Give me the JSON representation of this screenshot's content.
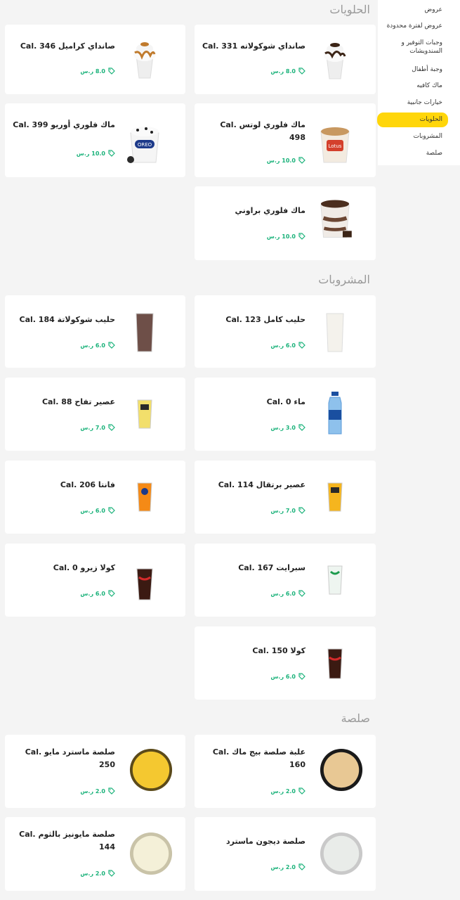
{
  "sidebar": {
    "items": [
      {
        "label": "عروض"
      },
      {
        "label": "عروض لفترة محدودة"
      },
      {
        "label": "وجبات التوفير و السندويشات"
      },
      {
        "label": "وجبة أطفال"
      },
      {
        "label": "ماك كافيه"
      },
      {
        "label": "خيارات جانبية"
      },
      {
        "label": "الحلويات"
      },
      {
        "label": "المشروبات"
      },
      {
        "label": "صلصة"
      }
    ],
    "active_index": 6,
    "active_color": "#ffd60a"
  },
  "sections": {
    "desserts": "الحلويات",
    "drinks": "المشروبات",
    "sauces": "صلصة"
  },
  "cards": {
    "sundae_choc": {
      "name": "صانداي شوكولاته Cal. 331",
      "price": "8.0 ر.س"
    },
    "sundae_caramel": {
      "name": "صانداي كراميل Cal. 346",
      "price": "8.0 ر.س"
    },
    "mcflurry_lotus": {
      "name": "ماك فلوري لوتس Cal. 498",
      "price": "10.0 ر.س"
    },
    "mcflurry_oreo": {
      "name": "ماك فلوري أوريو Cal. 399",
      "price": "10.0 ر.س"
    },
    "mcflurry_brownie": {
      "name": "ماك فلوري براوني",
      "price": "10.0 ر.س"
    },
    "milk_full": {
      "name": "حليب كامل Cal. 123",
      "price": "6.0 ر.س"
    },
    "milk_choc": {
      "name": "حليب شوكولاتة Cal. 184",
      "price": "6.0 ر.س"
    },
    "water": {
      "name": "ماء Cal. 0",
      "price": "3.0 ر.س"
    },
    "apple_juice": {
      "name": "عصير تفاح Cal. 88",
      "price": "7.0 ر.س"
    },
    "orange_juice": {
      "name": "عصير برتقال Cal. 114",
      "price": "7.0 ر.س"
    },
    "fanta": {
      "name": "فانتا Cal. 206",
      "price": "6.0 ر.س"
    },
    "sprite": {
      "name": "سبرايت Cal. 167",
      "price": "6.0 ر.س"
    },
    "cola_zero": {
      "name": "كولا زيرو Cal. 0",
      "price": "6.0 ر.س"
    },
    "cola": {
      "name": "كولا Cal. 150",
      "price": "6.0 ر.س"
    },
    "bigmac_sauce": {
      "name": "علبة صلصة بيج ماك Cal. 160",
      "price": "2.0 ر.س"
    },
    "mustard_mayo": {
      "name": "صلصة ماسترد مايو Cal. 250",
      "price": "2.0 ر.س"
    },
    "dijon_mustard": {
      "name": "صلصة ديجون ماسترد",
      "price": "2.0 ر.س"
    },
    "garlic_mayo": {
      "name": "صلصة مايونيز بالثوم Cal. 144",
      "price": "2.0 ر.س"
    }
  },
  "colors": {
    "price": "#1ab27a",
    "section_title": "#9a9a9a",
    "background": "#f4f4f4"
  }
}
